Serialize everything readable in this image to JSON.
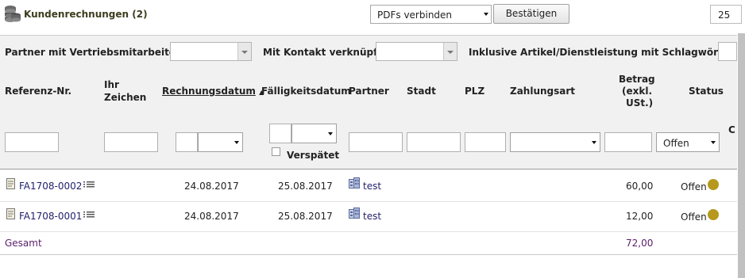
{
  "header": {
    "title": "Kundenrechnungen (2)",
    "bulk_action_value": "PDFs verbinden",
    "confirm_label": "Bestätigen",
    "page_size": "25"
  },
  "filters": {
    "sales_partner_label": "Partner mit Vertriebsmitarbeiter:",
    "contact_label": "Mit Kontakt verknüpft:",
    "keywords_label": "Inklusive Artikel/Dienstleistung mit Schlagwörter:"
  },
  "columns": {
    "ref": "Referenz-Nr.",
    "your_sign_1": "Ihr",
    "your_sign_2": "Zeichen",
    "invoice_date": "Rechnungsdatum",
    "due_date": "Fälligkeitsdatum",
    "partner": "Partner",
    "city": "Stadt",
    "zip": "PLZ",
    "payment": "Zahlungsart",
    "amount_1": "Betrag",
    "amount_2": "(exkl.",
    "amount_3": "USt.)",
    "status": "Status",
    "cut_off": "C"
  },
  "search": {
    "overdue_label": "Verspätet",
    "status_value": "Offen"
  },
  "rows": [
    {
      "ref": "FA1708-0002",
      "invoice_date": "24.08.2017",
      "due_date": "25.08.2017",
      "partner": "test",
      "amount": "60,00",
      "status": "Offen"
    },
    {
      "ref": "FA1708-0001",
      "invoice_date": "24.08.2017",
      "due_date": "25.08.2017",
      "partner": "test",
      "amount": "12,00",
      "status": "Offen"
    }
  ],
  "footer": {
    "total_label": "Gesamt",
    "total_amount": "72,00"
  },
  "colors": {
    "accent": "#1f1f6e",
    "total": "#5a1e6e",
    "status_dot": "#b6981e",
    "panel": "#f1f1f1"
  }
}
